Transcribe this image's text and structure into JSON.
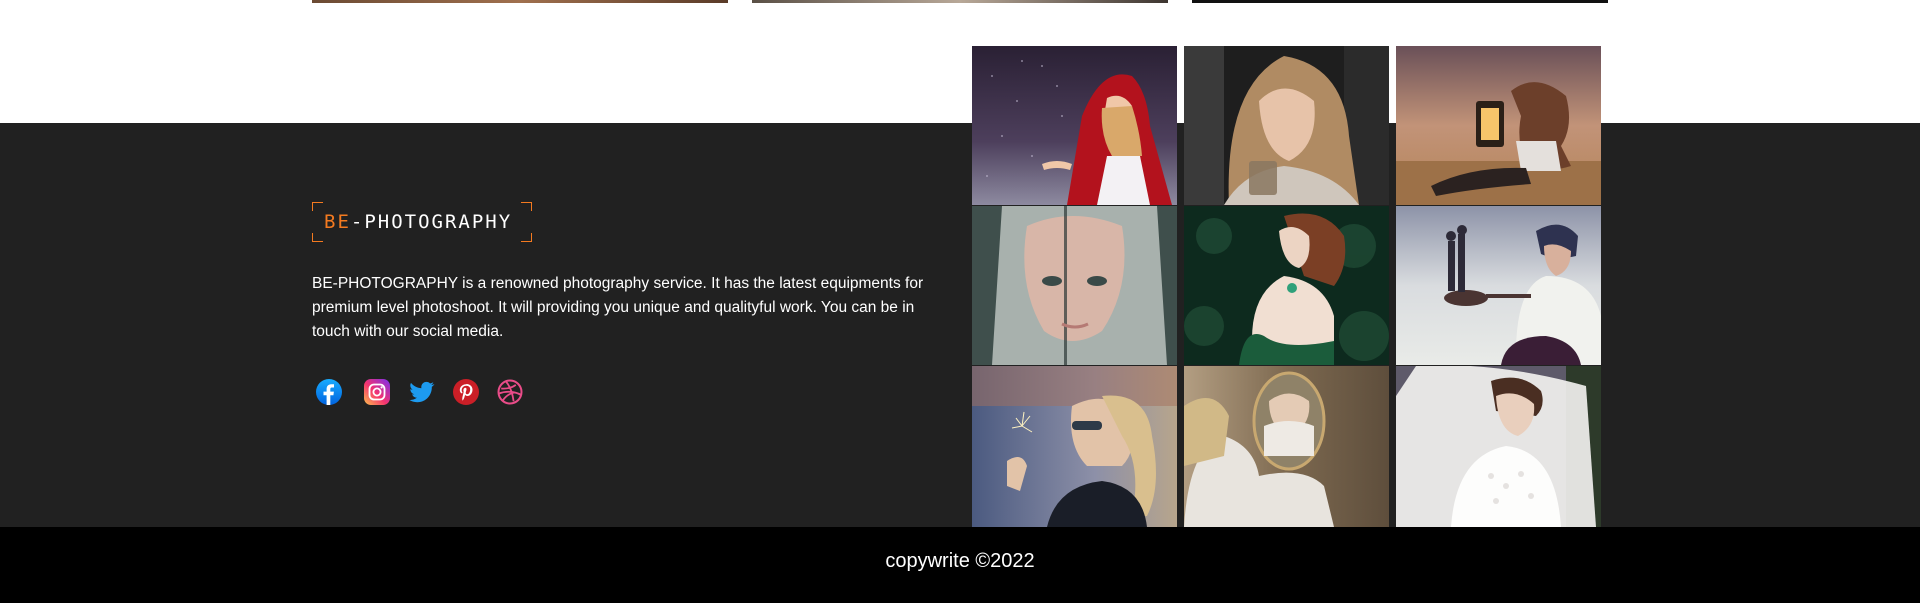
{
  "brand": {
    "logo_accent": "BE",
    "logo_rest": "-PHOTOGRAPHY",
    "accent_color": "#f47a20"
  },
  "footer": {
    "description": "BE-PHOTOGRAPHY is a renowned photography service. It has the latest equipments for premium level photoshoot. It will providing you unique and qualityful work. You can be in touch with our social media.",
    "socials": [
      {
        "name": "facebook-icon",
        "color": "#1877f2"
      },
      {
        "name": "instagram-icon",
        "color": "#d62976"
      },
      {
        "name": "twitter-icon",
        "color": "#1da1f2"
      },
      {
        "name": "pinterest-icon",
        "color": "#e60023"
      },
      {
        "name": "dribbble-icon",
        "color": "#ea4c89"
      }
    ],
    "copyright": "copywrite ©2022"
  },
  "gallery": {
    "tiles": [
      "red-riding-hood-girl-photo",
      "woman-holding-glass-photo",
      "girl-with-lantern-photo",
      "mirrored-face-portrait-photo",
      "woman-in-green-dress-photo",
      "man-with-pan-perspective-photo",
      "woman-with-sparkler-photo",
      "girl-in-mirror-photo",
      "bride-in-veil-photo"
    ]
  }
}
